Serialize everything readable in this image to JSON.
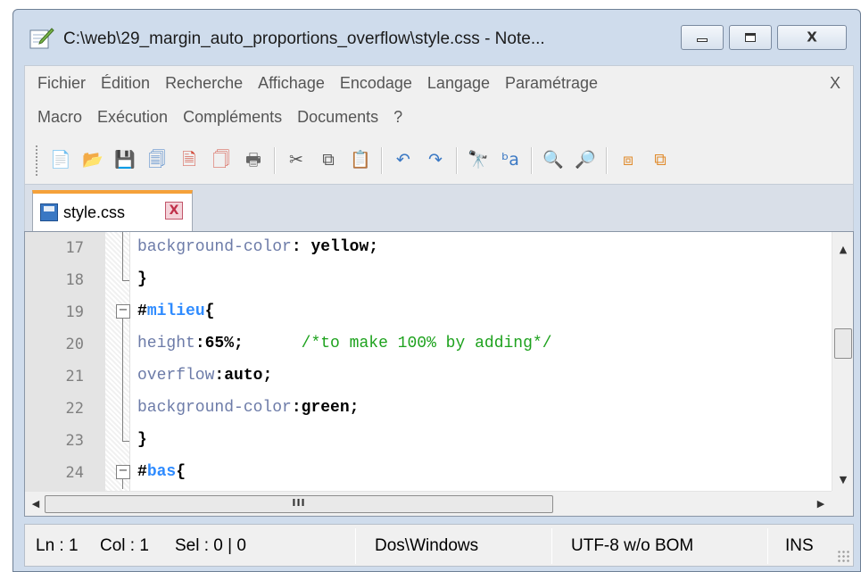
{
  "window": {
    "title": "C:\\web\\29_margin_auto_proportions_overflow\\style.css - Note...",
    "app_icon": "notepad-pencil-icon",
    "controls": {
      "minimize": "minimize-icon",
      "maximize": "maximize-icon",
      "close": "X"
    }
  },
  "menu": {
    "row1": [
      "Fichier",
      "Édition",
      "Recherche",
      "Affichage",
      "Encodage",
      "Langage",
      "Paramétrage"
    ],
    "row2": [
      "Macro",
      "Exécution",
      "Compléments",
      "Documents",
      "?"
    ],
    "close": "X"
  },
  "toolbar": {
    "icons": [
      "new-file-icon",
      "open-file-icon",
      "save-icon",
      "save-all-icon",
      "close-icon",
      "close-all-icon",
      "print-icon",
      "cut-icon",
      "copy-icon",
      "paste-icon",
      "undo-icon",
      "redo-icon",
      "find-icon",
      "replace-icon",
      "zoom-in-icon",
      "zoom-out-icon",
      "sync-vertical-icon",
      "sync-horizontal-icon"
    ]
  },
  "tab": {
    "label": "style.css",
    "close": "X"
  },
  "editor": {
    "lines": [
      {
        "n": "17",
        "fold": "vline",
        "parts": [
          {
            "t": "background-color",
            "c": "prop"
          },
          {
            "t": ": ",
            "c": "punct"
          },
          {
            "t": "yellow",
            "c": "val"
          },
          {
            "t": ";",
            "c": "punct"
          }
        ]
      },
      {
        "n": "18",
        "fold": "end",
        "parts": [
          {
            "t": "}",
            "c": "punct"
          }
        ]
      },
      {
        "n": "19",
        "fold": "box",
        "parts": [
          {
            "t": "#",
            "c": "sel-hash"
          },
          {
            "t": "milieu",
            "c": "sel-name"
          },
          {
            "t": "{",
            "c": "punct"
          }
        ]
      },
      {
        "n": "20",
        "fold": "vline",
        "parts": [
          {
            "t": "height",
            "c": "prop"
          },
          {
            "t": ":",
            "c": "punct"
          },
          {
            "t": "65%",
            "c": "val"
          },
          {
            "t": ";",
            "c": "punct"
          },
          {
            "t": "      /*to make 100% by adding*/",
            "c": "comment"
          }
        ]
      },
      {
        "n": "21",
        "fold": "vline",
        "parts": [
          {
            "t": "overflow",
            "c": "prop"
          },
          {
            "t": ":",
            "c": "punct"
          },
          {
            "t": "auto",
            "c": "val"
          },
          {
            "t": ";",
            "c": "punct"
          }
        ]
      },
      {
        "n": "22",
        "fold": "vline",
        "parts": [
          {
            "t": "background-color",
            "c": "prop"
          },
          {
            "t": ":",
            "c": "punct"
          },
          {
            "t": "green",
            "c": "val"
          },
          {
            "t": ";",
            "c": "punct"
          }
        ]
      },
      {
        "n": "23",
        "fold": "end",
        "parts": [
          {
            "t": "}",
            "c": "punct"
          }
        ]
      },
      {
        "n": "24",
        "fold": "box",
        "parts": [
          {
            "t": "#",
            "c": "sel-hash"
          },
          {
            "t": "bas",
            "c": "sel-name"
          },
          {
            "t": "{",
            "c": "punct"
          }
        ]
      }
    ],
    "hscroll_grip": "III"
  },
  "status": {
    "ln": "Ln : 1",
    "col": "Col : 1",
    "sel": "Sel : 0 | 0",
    "eol": "Dos\\Windows",
    "encoding": "UTF-8 w/o BOM",
    "mode": "INS"
  },
  "colors": {
    "accent_tab": "#f5a13a",
    "selector": "#2e8bff",
    "property": "#6c7ba8",
    "comment": "#1ea21e"
  }
}
